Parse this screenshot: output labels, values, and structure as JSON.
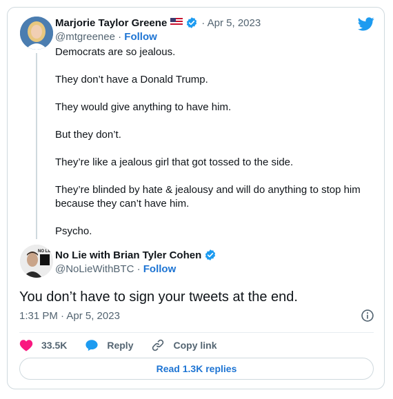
{
  "quoted_tweet": {
    "author_name": "Marjorie Taylor Greene",
    "date": "· Apr 5, 2023",
    "handle": "@mtgreenee",
    "follow_label": "Follow",
    "paragraphs": [
      "Democrats are so jealous.",
      "They don’t have a Donald Trump.",
      "They would give anything to have him.",
      "But they don’t.",
      "They’re like a jealous girl that got tossed to the side.",
      "They’re blinded by hate & jealousy and will do anything to stop him because they can’t have him.",
      "Psycho."
    ]
  },
  "reply_tweet": {
    "author_name": "No Lie with Brian Tyler Cohen",
    "handle": "@NoLieWithBTC",
    "follow_label": "Follow",
    "text": "You don’t have to sign your tweets at the end.",
    "timestamp": "1:31 PM · Apr 5, 2023",
    "avatar_text": "NO LIE"
  },
  "actions": {
    "likes": "33.5K",
    "reply_label": "Reply",
    "copy_link_label": "Copy link",
    "read_replies_label": "Read 1.3K replies"
  },
  "colors": {
    "accent": "#1d74d3",
    "twitter_blue": "#1d9bf0",
    "like_pink": "#f91880",
    "muted_text": "#536471"
  },
  "icons": [
    "twitter-bird-icon",
    "verified-badge-icon",
    "us-flag-icon",
    "info-icon",
    "heart-icon",
    "reply-bubble-icon",
    "link-icon"
  ]
}
